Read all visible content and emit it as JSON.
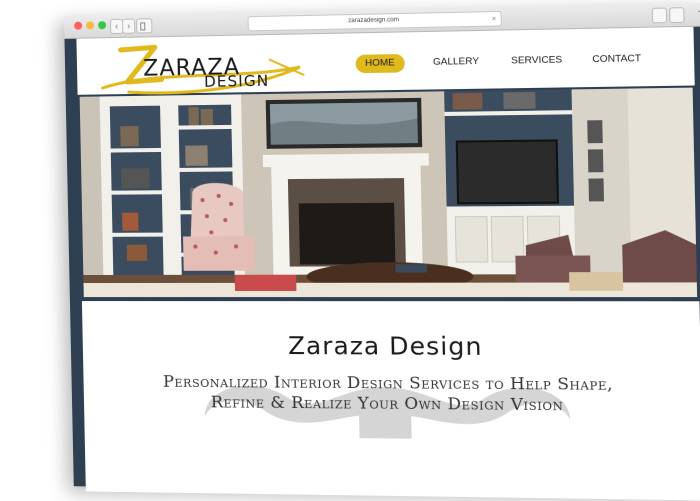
{
  "browser": {
    "url": "zarazadesign.com",
    "nav_back": "‹",
    "nav_forward": "›",
    "clear_icon": "×",
    "plus_icon": "+"
  },
  "site": {
    "logo": {
      "line1": "ZARAZA",
      "line2": "DESIGN",
      "accent_color": "#e0b91e"
    },
    "nav": [
      {
        "label": "HOME",
        "active": true
      },
      {
        "label": "GALLERY",
        "active": false
      },
      {
        "label": "SERVICES",
        "active": false
      },
      {
        "label": "CONTACT",
        "active": false
      }
    ],
    "hero_title": "Zaraza Design",
    "tagline": "Personalized Interior Design Services to Help Shape, Refine & Realize Your Own Design Vision"
  },
  "colors": {
    "frame": "#2f3f52",
    "accent": "#e0b91e"
  }
}
